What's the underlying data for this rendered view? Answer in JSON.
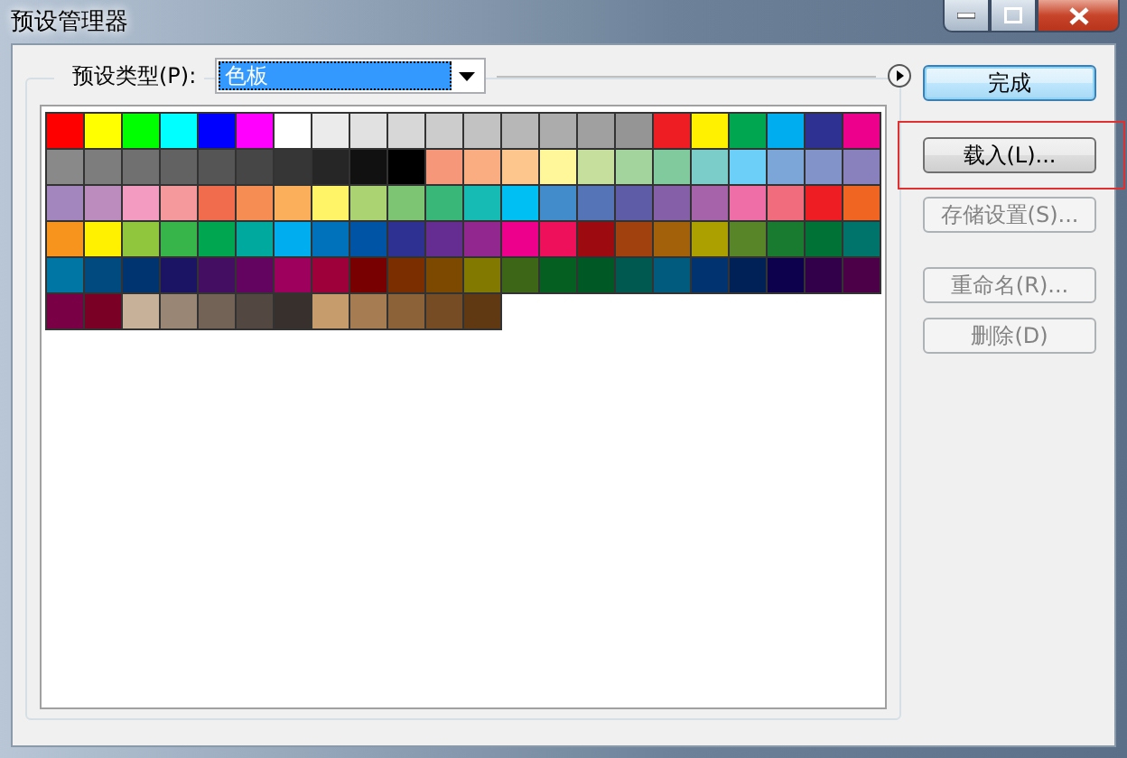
{
  "window": {
    "title": "预设管理器"
  },
  "preset_type": {
    "label": "预设类型(P):",
    "value": "色板"
  },
  "swatch_rows": [
    [
      {
        "color": "#ff0000"
      },
      {
        "color": "#ffff00"
      },
      {
        "color": "#00ff00"
      },
      {
        "color": "#00ffff"
      },
      {
        "color": "#0000ff"
      },
      {
        "color": "#ff00ff"
      },
      {
        "color": "#ffffff"
      },
      {
        "color": "#ebebeb"
      },
      {
        "color": "#e1e1e1"
      },
      {
        "color": "#d7d7d7"
      },
      {
        "color": "#cccccc"
      },
      {
        "color": "#c2c2c2"
      },
      {
        "color": "#b7b7b7"
      },
      {
        "color": "#acacac"
      },
      {
        "color": "#a0a0a0"
      },
      {
        "color": "#959595"
      },
      {
        "color": "#ee1d24"
      },
      {
        "color": "#fff100"
      },
      {
        "color": "#00a650"
      },
      {
        "color": "#00aeef"
      },
      {
        "color": "#2f3192"
      },
      {
        "color": "#ed008c"
      }
    ],
    [
      {
        "color": "#898989"
      },
      {
        "color": "#7d7d7d"
      },
      {
        "color": "#707070"
      },
      {
        "color": "#626262"
      },
      {
        "color": "#555555"
      },
      {
        "color": "#464646"
      },
      {
        "color": "#363636"
      },
      {
        "color": "#262626"
      },
      {
        "color": "#111111"
      },
      {
        "color": "#000000"
      },
      {
        "color": "#f7977a"
      },
      {
        "color": "#fbad82"
      },
      {
        "color": "#fdc68c"
      },
      {
        "color": "#fff799"
      },
      {
        "color": "#c6df9c"
      },
      {
        "color": "#a4d49d"
      },
      {
        "color": "#81ca9d"
      },
      {
        "color": "#7bcdc9"
      },
      {
        "color": "#6ccff7"
      },
      {
        "color": "#7ca6d8"
      },
      {
        "color": "#8293ca"
      },
      {
        "color": "#8881be"
      }
    ],
    [
      {
        "color": "#a286bd"
      },
      {
        "color": "#bc8cbf"
      },
      {
        "color": "#f49bc1"
      },
      {
        "color": "#f5999d"
      },
      {
        "color": "#f16c4d"
      },
      {
        "color": "#f68e54"
      },
      {
        "color": "#fbaf5a"
      },
      {
        "color": "#fff467"
      },
      {
        "color": "#acd372"
      },
      {
        "color": "#7dc473"
      },
      {
        "color": "#39b778"
      },
      {
        "color": "#16bcb4"
      },
      {
        "color": "#00bff3"
      },
      {
        "color": "#438ccb"
      },
      {
        "color": "#5573b7"
      },
      {
        "color": "#5e5ca7"
      },
      {
        "color": "#855fa8"
      },
      {
        "color": "#a763a9"
      },
      {
        "color": "#ef6ea8"
      },
      {
        "color": "#f16d7e"
      },
      {
        "color": "#ee1d24"
      },
      {
        "color": "#f16522"
      }
    ],
    [
      {
        "color": "#f7941d"
      },
      {
        "color": "#fff100"
      },
      {
        "color": "#8fc63d"
      },
      {
        "color": "#37b44a"
      },
      {
        "color": "#00a650"
      },
      {
        "color": "#00a99e"
      },
      {
        "color": "#00aeef"
      },
      {
        "color": "#0072bc"
      },
      {
        "color": "#0054a5"
      },
      {
        "color": "#2f3192"
      },
      {
        "color": "#652c91"
      },
      {
        "color": "#91278f"
      },
      {
        "color": "#ed008c"
      },
      {
        "color": "#ee105a"
      },
      {
        "color": "#9d0a0f"
      },
      {
        "color": "#a1410d"
      },
      {
        "color": "#a36209"
      },
      {
        "color": "#aba000"
      },
      {
        "color": "#588528"
      },
      {
        "color": "#197b30"
      },
      {
        "color": "#007236"
      },
      {
        "color": "#00736a"
      }
    ],
    [
      {
        "color": "#0076a4"
      },
      {
        "color": "#004a80"
      },
      {
        "color": "#003471"
      },
      {
        "color": "#1b1464"
      },
      {
        "color": "#440e62"
      },
      {
        "color": "#630460"
      },
      {
        "color": "#9e005d"
      },
      {
        "color": "#9e0039"
      },
      {
        "color": "#790000"
      },
      {
        "color": "#7b2e00"
      },
      {
        "color": "#7d4900"
      },
      {
        "color": "#827a00"
      },
      {
        "color": "#3e6617"
      },
      {
        "color": "#045f20"
      },
      {
        "color": "#005824"
      },
      {
        "color": "#005951"
      },
      {
        "color": "#005b7e"
      },
      {
        "color": "#003370"
      },
      {
        "color": "#002157"
      },
      {
        "color": "#0d004c"
      },
      {
        "color": "#32004b"
      },
      {
        "color": "#4b0048"
      }
    ],
    [
      {
        "color": "#7a0045"
      },
      {
        "color": "#7a0026"
      },
      {
        "color": "#c7b299"
      },
      {
        "color": "#998675"
      },
      {
        "color": "#736357"
      },
      {
        "color": "#534741"
      },
      {
        "color": "#37302d"
      },
      {
        "color": "#c69c6d"
      },
      {
        "color": "#a67c52"
      },
      {
        "color": "#8c6239"
      },
      {
        "color": "#754c24"
      },
      {
        "color": "#603913"
      }
    ]
  ],
  "buttons": [
    {
      "label": "完成",
      "kind": "default",
      "disabled": false,
      "highlighted": false
    },
    {
      "label": "载入(L)...",
      "kind": "normal",
      "disabled": false,
      "highlighted": true
    },
    {
      "label": "存储设置(S)...",
      "kind": "normal",
      "disabled": true,
      "highlighted": false
    },
    {
      "label": "重命名(R)...",
      "kind": "normal",
      "disabled": true,
      "highlighted": false
    },
    {
      "label": "删除(D)",
      "kind": "normal",
      "disabled": true,
      "highlighted": false
    }
  ]
}
